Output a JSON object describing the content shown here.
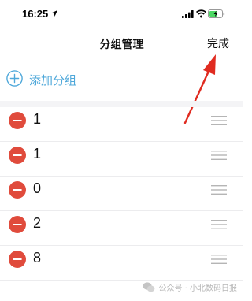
{
  "status_bar": {
    "time": "16:25",
    "icons": [
      "location-arrow-icon",
      "cellular-signal-icon",
      "wifi-icon",
      "battery-charging-icon"
    ]
  },
  "nav": {
    "title": "分组管理",
    "done_label": "完成"
  },
  "add_group": {
    "label": "添加分组",
    "icon": "plus-circle-icon"
  },
  "groups": [
    {
      "label": "1"
    },
    {
      "label": "1"
    },
    {
      "label": "0"
    },
    {
      "label": "2"
    },
    {
      "label": "8"
    }
  ],
  "watermark": {
    "text": "公众号 · 小北数码日报"
  },
  "colors": {
    "accent": "#4fa8da",
    "delete": "#e04b3c",
    "annotation_arrow": "#e02b20",
    "handle": "#b5b5b5"
  }
}
